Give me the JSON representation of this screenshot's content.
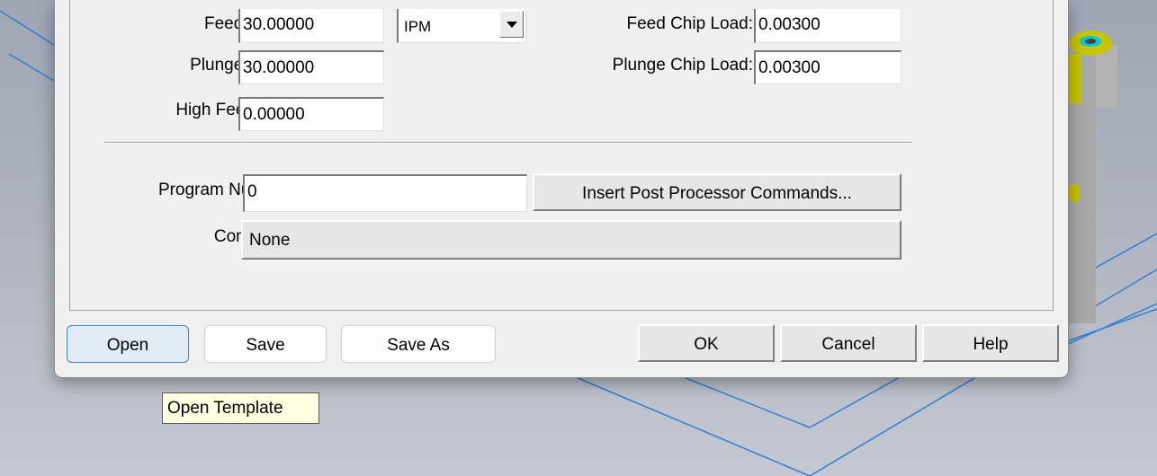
{
  "form": {
    "feed_rate": {
      "label": "Feed Rate:",
      "value": "30.00000"
    },
    "plunge_rate": {
      "label": "Plunge Rate:",
      "value": "30.00000"
    },
    "high_feedrate": {
      "label": "High Feedrate:",
      "value": "0.00000"
    },
    "units": {
      "selected": "IPM"
    },
    "feed_chip_load": {
      "label": "Feed Chip Load:",
      "value": "0.00300"
    },
    "plunge_chip_load": {
      "label": "Plunge Chip Load:",
      "value": "0.00300"
    },
    "program_number": {
      "label": "Program Number:",
      "value": "0"
    },
    "insert_post_button": "Insert Post Processor Commands...",
    "comments": {
      "label": "Comments:",
      "value": "None"
    }
  },
  "buttons": {
    "open": "Open",
    "save": "Save",
    "save_as": "Save As",
    "ok": "OK",
    "cancel": "Cancel",
    "help": "Help"
  },
  "tooltip": "Open Template",
  "colors": {
    "dialog_bg": "#f0f0f0",
    "tooltip_bg": "#ffffe1",
    "focus_border": "#3f84d4",
    "model_yellow": "#c8c400",
    "model_cyan": "#00c8d8",
    "viewport_lines": "#2e7fd6"
  }
}
